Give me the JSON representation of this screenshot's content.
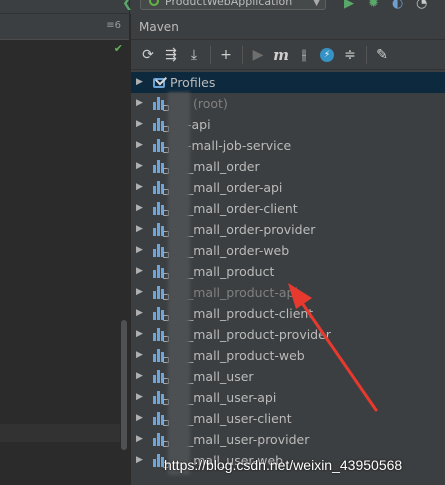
{
  "run_config": {
    "label": "ProductWebApplication"
  },
  "maven_panel": {
    "title": "Maven",
    "toolbar": {
      "buttons": [
        {
          "name": "reload-icon",
          "glyph": "⟳"
        },
        {
          "name": "generate-sources-icon",
          "glyph": "⧉"
        },
        {
          "name": "download-icon",
          "glyph": "⤓"
        },
        {
          "name": "add-icon",
          "glyph": "+"
        },
        {
          "name": "run-icon",
          "glyph": "▶"
        },
        {
          "name": "maven-goal-icon",
          "glyph": "m"
        },
        {
          "name": "toggle-offline-icon",
          "glyph": "∤"
        },
        {
          "name": "skip-tests-icon",
          "glyph": "⚡"
        },
        {
          "name": "collapse-all-icon",
          "glyph": "≑"
        },
        {
          "name": "settings-wrench-icon",
          "glyph": "🔧"
        }
      ]
    },
    "tree": [
      {
        "label": "Profiles",
        "type": "profiles",
        "selected": true
      },
      {
        "label": "(root)",
        "type": "module",
        "muted": true
      },
      {
        "label": "-api",
        "type": "module"
      },
      {
        "label": "-mall-job-service",
        "type": "module"
      },
      {
        "label": "_mall_order",
        "type": "module"
      },
      {
        "label": "_mall_order-api",
        "type": "module"
      },
      {
        "label": "_mall_order-client",
        "type": "module"
      },
      {
        "label": "_mall_order-provider",
        "type": "module"
      },
      {
        "label": "_mall_order-web",
        "type": "module"
      },
      {
        "label": "_mall_product",
        "type": "module"
      },
      {
        "label": "_mall_product-api",
        "type": "module",
        "muted": true
      },
      {
        "label": "_mall_product-client",
        "type": "module"
      },
      {
        "label": "_mall_product-provider",
        "type": "module"
      },
      {
        "label": "_mall_product-web",
        "type": "module"
      },
      {
        "label": "_mall_user",
        "type": "module"
      },
      {
        "label": "_mall_user-api",
        "type": "module"
      },
      {
        "label": "_mall_user-client",
        "type": "module"
      },
      {
        "label": "_mall_user-provider",
        "type": "module"
      },
      {
        "label": "_mall_user-web",
        "type": "module"
      }
    ]
  },
  "editor": {
    "menu_glyph": "≡6",
    "check_glyph": "✔"
  },
  "watermark": "https://blog.csdn.net/weixin_43950568",
  "colors": {
    "annotation_arrow": "#e8392e",
    "selection": "#0d293e"
  }
}
